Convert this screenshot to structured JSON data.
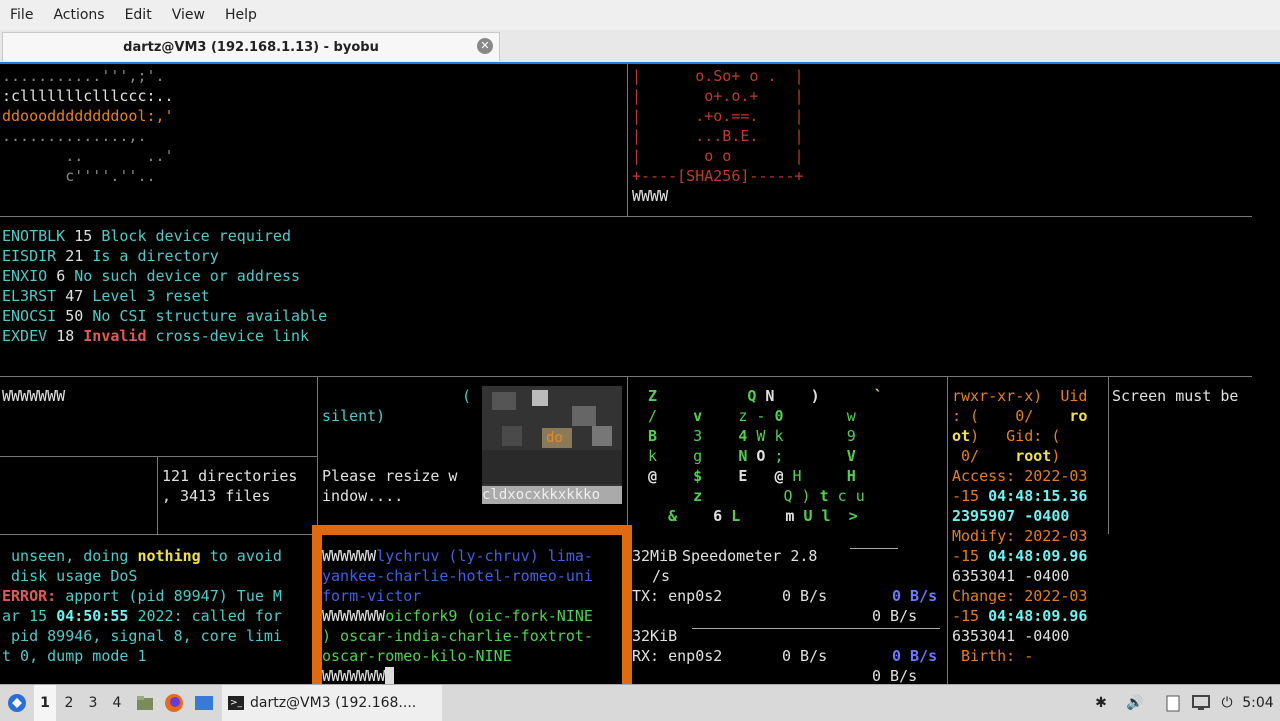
{
  "menu": {
    "items": [
      "File",
      "Actions",
      "Edit",
      "View",
      "Help"
    ]
  },
  "tab": {
    "title": "dartz@VM3 (192.168.1.13) - byobu"
  },
  "pane_top_left": {
    "lines": [
      "...........''',;'.",
      ":clllllllclllccc:..",
      "ddoooddddddddool:,'",
      "..............,.",
      "       ..       ..'",
      "       c''''.''.."
    ]
  },
  "pane_top_right": {
    "lines": [
      "|      o.So+ o .  |",
      "|       o+.o.+    |",
      "|      .+o.==.    |",
      "|      ...B.E.    |",
      "|       o o       |",
      "+----[SHA256]-----+"
    ],
    "footer": "WWWW"
  },
  "errors": [
    {
      "code": "ENOTBLK",
      "num": "15",
      "msg": "Block device required"
    },
    {
      "code": "EISDIR",
      "num": "21",
      "msg": "Is a directory"
    },
    {
      "code": "ENXIO",
      "num": "6",
      "msg": "No such device or address"
    },
    {
      "code": "EL3RST",
      "num": "47",
      "msg": "Level 3 reset"
    },
    {
      "code": "ENOCSI",
      "num": "50",
      "msg": "No CSI structure available"
    },
    {
      "code": "EXDEV",
      "num": "18",
      "msg_hl": "Invalid",
      "msg": "cross-device link"
    }
  ],
  "mid": {
    "w1": "WWWWWWW",
    "paren": "(",
    "silent": "silent)",
    "dirs_l1": "121 directories",
    "dirs_l2": ", 3413 files",
    "resize_l1": "Please resize w",
    "resize_l2": "indow....",
    "img_caption": "cldxocxkkxkkko",
    "img_mid": "do"
  },
  "matrix": {
    "rows": [
      [
        "Z",
        "",
        "",
        "Q",
        "N",
        "",
        ")",
        "",
        "`"
      ],
      [
        "/",
        "",
        "v",
        "z",
        "-",
        "0",
        "",
        "",
        "w"
      ],
      [
        "B",
        "",
        "3",
        "4",
        "W",
        "k",
        "",
        "",
        "9"
      ],
      [
        "k",
        "",
        "g",
        "N",
        "O",
        ";",
        "",
        "",
        "V"
      ],
      [
        "@",
        "",
        "$",
        "E",
        "",
        "@",
        "H",
        "",
        "H"
      ],
      [
        "",
        "",
        "z",
        "",
        "",
        "Q",
        ")",
        "t",
        "c",
        "u"
      ],
      [
        "&",
        "",
        "6",
        "L",
        "",
        "",
        "m",
        "U",
        "l",
        ">"
      ]
    ]
  },
  "stat": {
    "l1": "rwxr-xr-x)  Uid",
    "l2a": ": (    0/    ",
    "l2b": "ro",
    "l3a": "ot",
    "l3b": ")   Gid: (",
    "l4a": " 0/    ",
    "l4b": "root",
    "l5": "Access: 2022-03",
    "l6a": "-15 ",
    "l6b": "04:48:15.36",
    "l7": "2395907 -0400",
    "l8": "Modify: 2022-03",
    "l9a": "-15 ",
    "l9b": "04:48:09.96",
    "l10": "6353041 -0400",
    "l11": "Change: 2022-03",
    "l12a": "-15 ",
    "l12b": "04:48:09.96",
    "l13": "6353041 -0400",
    "l14": " Birth: -"
  },
  "screen_msg": "Screen must be",
  "apport": {
    "l1a": " unseen, doing ",
    "l1b": "nothing",
    "l1c": " to avoid",
    "l2": " disk usage DoS",
    "l3a": "ERROR:",
    "l3b": " apport (pid 89947) Tue M",
    "l4a": "ar 15 ",
    "l4b": "04:50:55",
    "l4c": " 2022: called for",
    "l5": " pid 89946, signal 8, core limi",
    "l6": "t 0, dump mode 1"
  },
  "orange": {
    "l1a": "WWWWWW",
    "l1b": "lychruv (ly-chruv) lima-",
    "l2": "yankee-charlie-hotel-romeo-uni",
    "l3": "form-victor",
    "l4a": "WWWWWWW",
    "l4b": "oicfork9 (oic-fork-NINE",
    "l5": ") oscar-india-charlie-foxtrot-",
    "l6": "oscar-romeo-kilo-NINE",
    "l7": "WWWWWWW"
  },
  "net": {
    "mib": "32MiB",
    "s": "/s",
    "speed": "Speedometer 2.8",
    "tx_label": "TX: enp0s2",
    "tx_val": "0 B/s",
    "tx_val2": "0 B/s",
    "tx_bold": "0 B/s",
    "kib": "32KiB",
    "rx_label": "RX: enp0s2",
    "rx_val": "0 B/s",
    "rx_val2": "0 B/s",
    "rx_bold": "0 B/s"
  },
  "taskbar": {
    "workspaces": [
      "1",
      "2",
      "3",
      "4"
    ],
    "task": "dartz@VM3 (192.168....",
    "clock": "5:04"
  }
}
